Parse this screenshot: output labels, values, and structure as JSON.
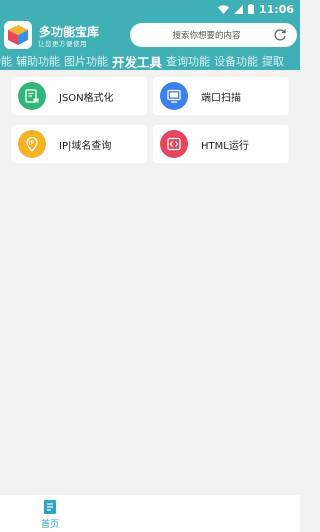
{
  "status_bar": {
    "time": "11:06",
    "icons": [
      "wifi-icon",
      "signal-icon",
      "battery-icon"
    ]
  },
  "header": {
    "title": "多功能宝库",
    "subtitle": "让您更方便使用",
    "search_placeholder": "搜索你想要的内容",
    "background_color": "#40b0b6"
  },
  "tabs": [
    {
      "label": "功能",
      "active": false
    },
    {
      "label": "辅助功能",
      "active": false
    },
    {
      "label": "图片功能",
      "active": false
    },
    {
      "label": "开发工具",
      "active": true
    },
    {
      "label": "查询功能",
      "active": false
    },
    {
      "label": "设备功能",
      "active": false
    },
    {
      "label": "提取",
      "active": false
    }
  ],
  "tools": [
    {
      "label": "JSON格式化",
      "icon": "json-file-icon",
      "color": "#2fb57a"
    },
    {
      "label": "端口扫描",
      "icon": "monitor-icon",
      "color": "#3c7ff0"
    },
    {
      "label": "IP|域名查询",
      "icon": "ip-location-icon",
      "color": "#f5b324"
    },
    {
      "label": "HTML运行",
      "icon": "code-icon",
      "color": "#e8455a"
    }
  ],
  "bottom_nav": {
    "home_label": "首页",
    "active_color": "#2aa6c4"
  }
}
